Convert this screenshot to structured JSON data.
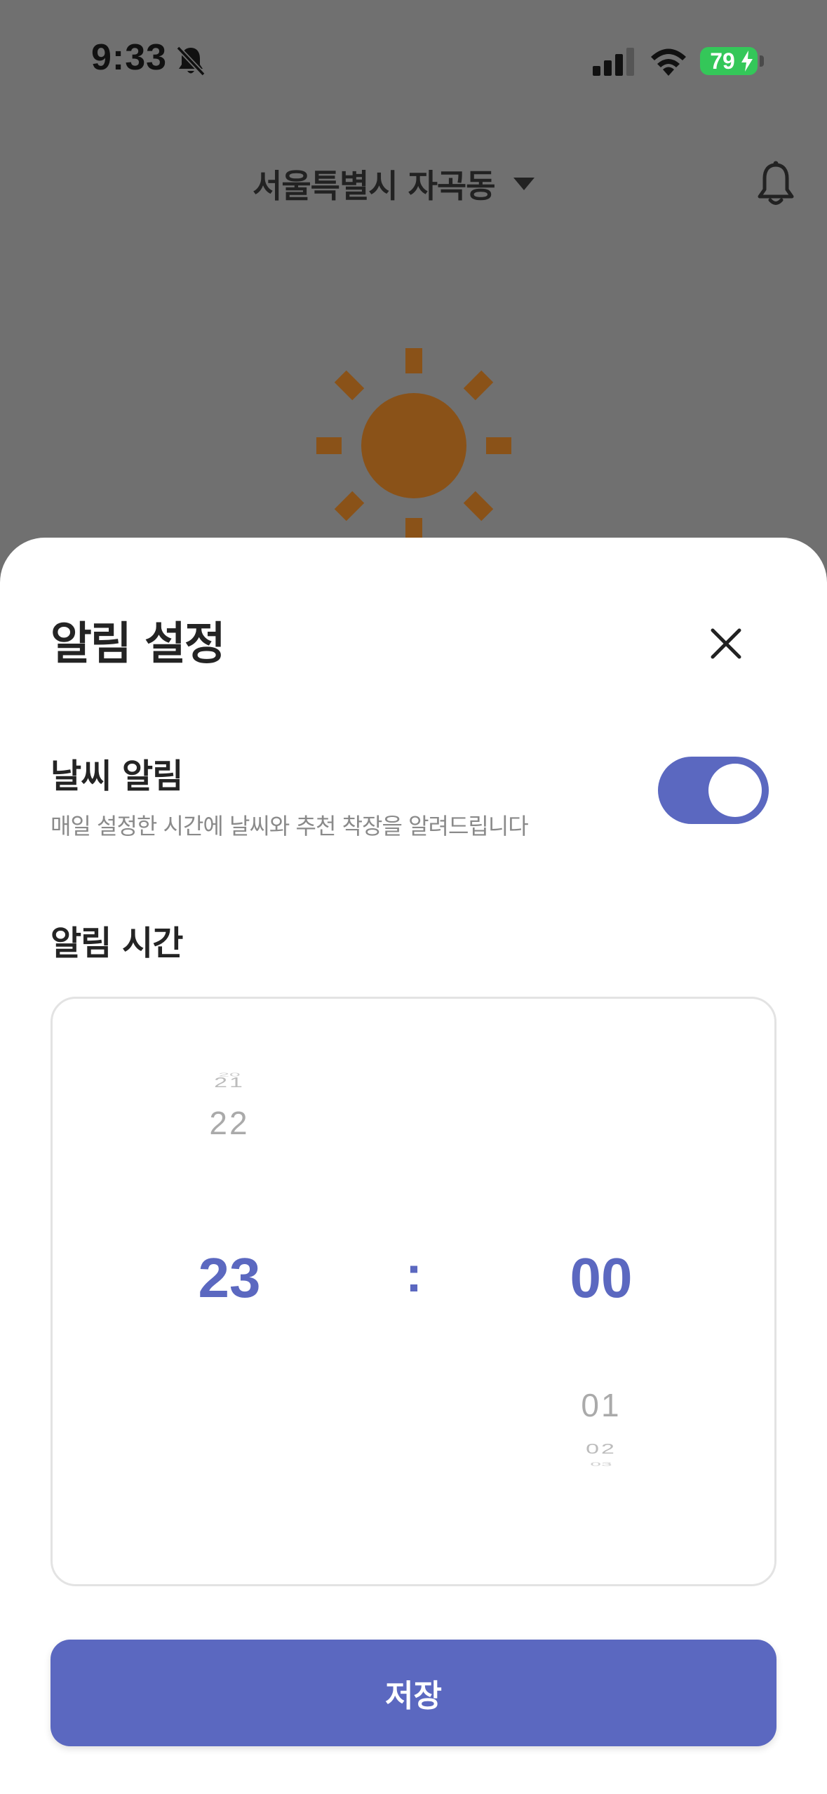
{
  "status_bar": {
    "time": "9:33",
    "battery": "79"
  },
  "header": {
    "location": "서울특별시 자곡동",
    "icons": [
      "caret-down-icon",
      "bell-icon",
      "sun-icon"
    ]
  },
  "sheet": {
    "title": "알림 설정",
    "weather_alert": {
      "title": "날씨 알림",
      "description": "매일 설정한 시간에 날씨와 추천 착장을 알려드립니다",
      "enabled": true
    },
    "time_section_label": "알림 시간",
    "picker": {
      "hours_above": [
        "20",
        "21",
        "22"
      ],
      "selected_hour": "23",
      "separator": ":",
      "selected_minute": "00",
      "minutes_below": [
        "01",
        "02",
        "03"
      ]
    },
    "save_label": "저장"
  },
  "colors": {
    "accent": "#5b68c0",
    "sun": "#8a5218",
    "overlay": "#707070",
    "battery": "#34c759"
  }
}
